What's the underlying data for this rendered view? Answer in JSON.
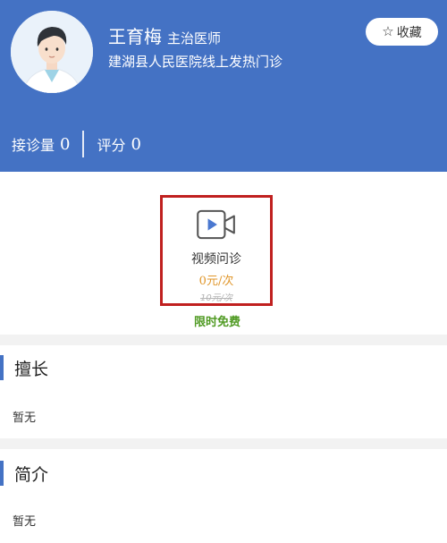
{
  "doctor": {
    "name": "王育梅",
    "title": "主治医师",
    "hospital": "建湖县人民医院线上发热门诊"
  },
  "favorite": {
    "icon": "star-outline-icon",
    "label": "收藏"
  },
  "stats": {
    "consult_label": "接诊量",
    "consult_value": "0",
    "rating_label": "评分",
    "rating_value": "0"
  },
  "service": {
    "icon": "video-camera-icon",
    "name": "视频问诊",
    "price": "0元/次",
    "original_price": "10元/次",
    "promo": "限时免费"
  },
  "sections": {
    "specialty": {
      "title": "擅长",
      "content": "暂无"
    },
    "intro": {
      "title": "简介",
      "content": "暂无"
    }
  },
  "colors": {
    "header_bg": "#4472c4",
    "card_border": "#c0201f",
    "price": "#e0962a",
    "promo": "#4f9a22",
    "section_bar": "#4472c4"
  }
}
